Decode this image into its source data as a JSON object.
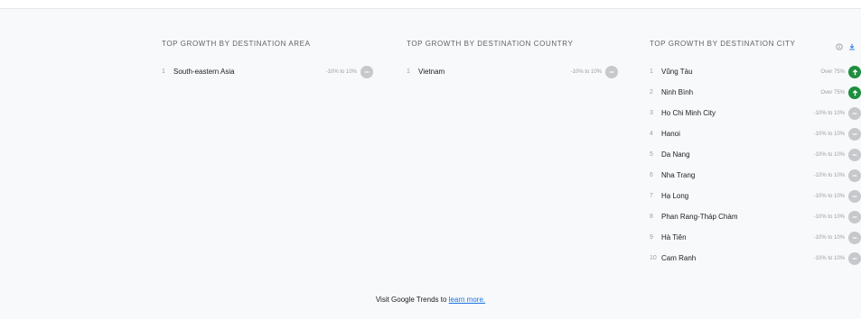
{
  "columns": [
    {
      "title": "TOP GROWTH BY DESTINATION AREA",
      "items": [
        {
          "rank": "1",
          "name": "South-eastern Asia",
          "range": "-10% to 10%",
          "trend": "flat"
        }
      ]
    },
    {
      "title": "TOP GROWTH BY DESTINATION COUNTRY",
      "items": [
        {
          "rank": "1",
          "name": "Vietnam",
          "range": "-10% to 10%",
          "trend": "flat"
        }
      ]
    },
    {
      "title": "TOP GROWTH BY DESTINATION CITY",
      "items": [
        {
          "rank": "1",
          "name": "Vũng Tàu",
          "range": "Over 75%",
          "trend": "up"
        },
        {
          "rank": "2",
          "name": "Ninh Bình",
          "range": "Over 75%",
          "trend": "up"
        },
        {
          "rank": "3",
          "name": "Ho Chi Minh City",
          "range": "-10% to 10%",
          "trend": "flat"
        },
        {
          "rank": "4",
          "name": "Hanoi",
          "range": "-10% to 10%",
          "trend": "flat"
        },
        {
          "rank": "5",
          "name": "Da Nang",
          "range": "-10% to 10%",
          "trend": "flat"
        },
        {
          "rank": "6",
          "name": "Nha Trang",
          "range": "-10% to 10%",
          "trend": "flat"
        },
        {
          "rank": "7",
          "name": "Hạ Long",
          "range": "-10% to 10%",
          "trend": "flat"
        },
        {
          "rank": "8",
          "name": "Phan Rang-Tháp Chàm",
          "range": "-10% to 10%",
          "trend": "flat"
        },
        {
          "rank": "9",
          "name": "Hà Tiên",
          "range": "-10% to 10%",
          "trend": "flat"
        },
        {
          "rank": "10",
          "name": "Cam Ranh",
          "range": "-10% to 10%",
          "trend": "flat"
        }
      ]
    }
  ],
  "toolbar": {
    "info_icon": "info-icon",
    "download_icon": "download-icon"
  },
  "footer": {
    "text": "Visit Google Trends to ",
    "link": "learn more."
  },
  "colors": {
    "up": "#1e8e3e",
    "flat": "#c6c9cc",
    "link": "#1a73e8"
  }
}
